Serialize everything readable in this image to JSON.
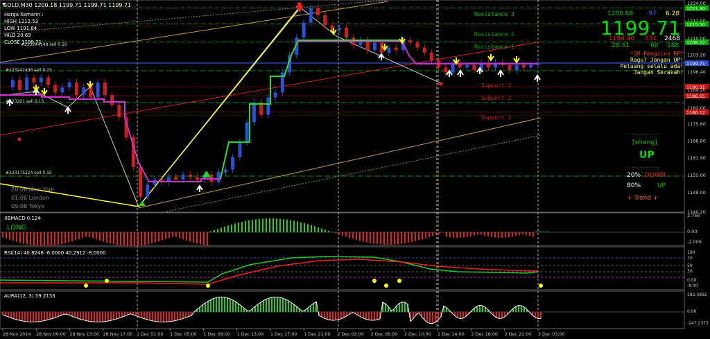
{
  "header": {
    "symbol_line": "GOLD,M30  1200.18 1199.71 1199.71 1199.71",
    "info_title": "Harga Kemarin :",
    "info_high": "HIGH 1212.53",
    "info_low": "LOW 1191.84",
    "info_hilo": "HILO 20.69",
    "info_close": "CLOSE 1199.71"
  },
  "prices": {
    "bid": "1199.71",
    "top_left": "1200.68",
    "top_mid": "-97",
    "top_right": "6.28",
    "row2_a": "1194.40",
    "row2_b": "531",
    "row2_c": "2468",
    "row3_a": "28:31",
    "row3_b": "60",
    "row3_c": "188"
  },
  "levels": {
    "resistance3": "Resistance 3",
    "resistance2": "Resistance 2",
    "resistance1": "Resistance 1",
    "support1": "Support 1",
    "support2": "Support 2",
    "support3": "Support 3"
  },
  "orders": {
    "sell1": "#223244148 sell 0.50",
    "sell2": "#223242438 sell 0.15",
    "sell3": "#223201 sell 0.15",
    "sell4": "#223175224 sell 0.15"
  },
  "sessions": {
    "ny": "20:06 New York",
    "london": "01:06 London",
    "tokyo": "09:06 Tokyo"
  },
  "motivation": {
    "line1": "*30 Pengicno RP*",
    "line2": "Ragu? Jangan OP!",
    "line3": "Peluang selalu ada!",
    "line4": "Jangan Serakah!"
  },
  "trend_panel": {
    "strength": "[strong]",
    "direction": "UP",
    "down_pct": "20%",
    "down_label": "DOWN",
    "up_pct": "80%",
    "up_label": "UP",
    "trend_label": "+  Trend  +",
    "dots": "............"
  },
  "sub_labels": {
    "xbmacd": "XBMACD 0.124",
    "long": "LONG",
    "rsi": "RSI(14) 40.8248 -6.0000 40.2912 -8.0000",
    "aura": "AURA(12, 3) 59.2153"
  },
  "price_axis": {
    "ticks": [
      "1224.00",
      "1217.00",
      "1210.00",
      "1203.20",
      "1196.40",
      "1189.20",
      "1182.00",
      "1175.60",
      "1168.80",
      "1161.90",
      "1155.00",
      "1148.00",
      "1140.20"
    ],
    "tags": [
      {
        "label": "1221.90",
        "color": "#00b000"
      },
      {
        "label": "1215.50",
        "color": "#00b000"
      },
      {
        "label": "1208.22",
        "color": "#00b000"
      },
      {
        "label": "1199.71",
        "color": "#3355cc"
      },
      {
        "label": "1190.31",
        "color": "#cc1111"
      },
      {
        "label": "1186.65",
        "color": "#cc1111"
      },
      {
        "label": "1180.12",
        "color": "#cc1111"
      }
    ]
  },
  "macd_axis": [
    "2.756",
    "0.00",
    "-2.006"
  ],
  "rsi_axis": [
    "100",
    "70",
    "50",
    "30",
    "0.00",
    "-8.00"
  ],
  "aura_axis": [
    "282.3992",
    "0.00",
    "-247.2373"
  ],
  "time_axis": [
    "28 Nov 2014",
    "28 Nov 09:00",
    "28 Nov 13:00",
    "28 Nov 17:00",
    "1 Dec 01:00",
    "1 Dec 05:00",
    "1 Dec 09:00",
    "1 Dec 13:00",
    "1 Dec 17:00",
    "1 Dec 21:00",
    "2 Dec 02:00",
    "2 Dec 06:00",
    "2 Dec 10:00",
    "2 Dec 14:00",
    "2 Dec 18:00",
    "2 Dec 22:00",
    "3 Dec 03:00"
  ],
  "chart_data": {
    "type": "candlestick",
    "symbol": "GOLD",
    "timeframe": "M30",
    "ylim": [
      1140.2,
      1224.0
    ],
    "x_start": "28 Nov 2014",
    "x_end": "3 Dec 03:00",
    "close_series": [
      1190,
      1193,
      1189,
      1194,
      1192,
      1194,
      1191,
      1188,
      1190,
      1192,
      1187,
      1190,
      1186,
      1192,
      1187,
      1183,
      1178,
      1170,
      1158,
      1146,
      1151,
      1153,
      1152,
      1154,
      1153,
      1155,
      1154,
      1153,
      1155,
      1152,
      1156,
      1157,
      1162,
      1168,
      1176,
      1184,
      1179,
      1186,
      1188,
      1196,
      1203,
      1210,
      1216,
      1222,
      1219,
      1215,
      1213,
      1214,
      1210,
      1207,
      1209,
      1205,
      1208,
      1204,
      1206,
      1205,
      1209,
      1208,
      1206,
      1204,
      1201,
      1198,
      1196,
      1200,
      1198,
      1199,
      1197,
      1200,
      1198,
      1200,
      1199,
      1197,
      1199,
      1198,
      1199,
      1199.71
    ],
    "levels": {
      "resistance3": 1221.9,
      "resistance2": 1215.5,
      "resistance1": 1208.22,
      "support1": 1190.31,
      "support2": 1186.65,
      "support3": 1180.12
    }
  }
}
